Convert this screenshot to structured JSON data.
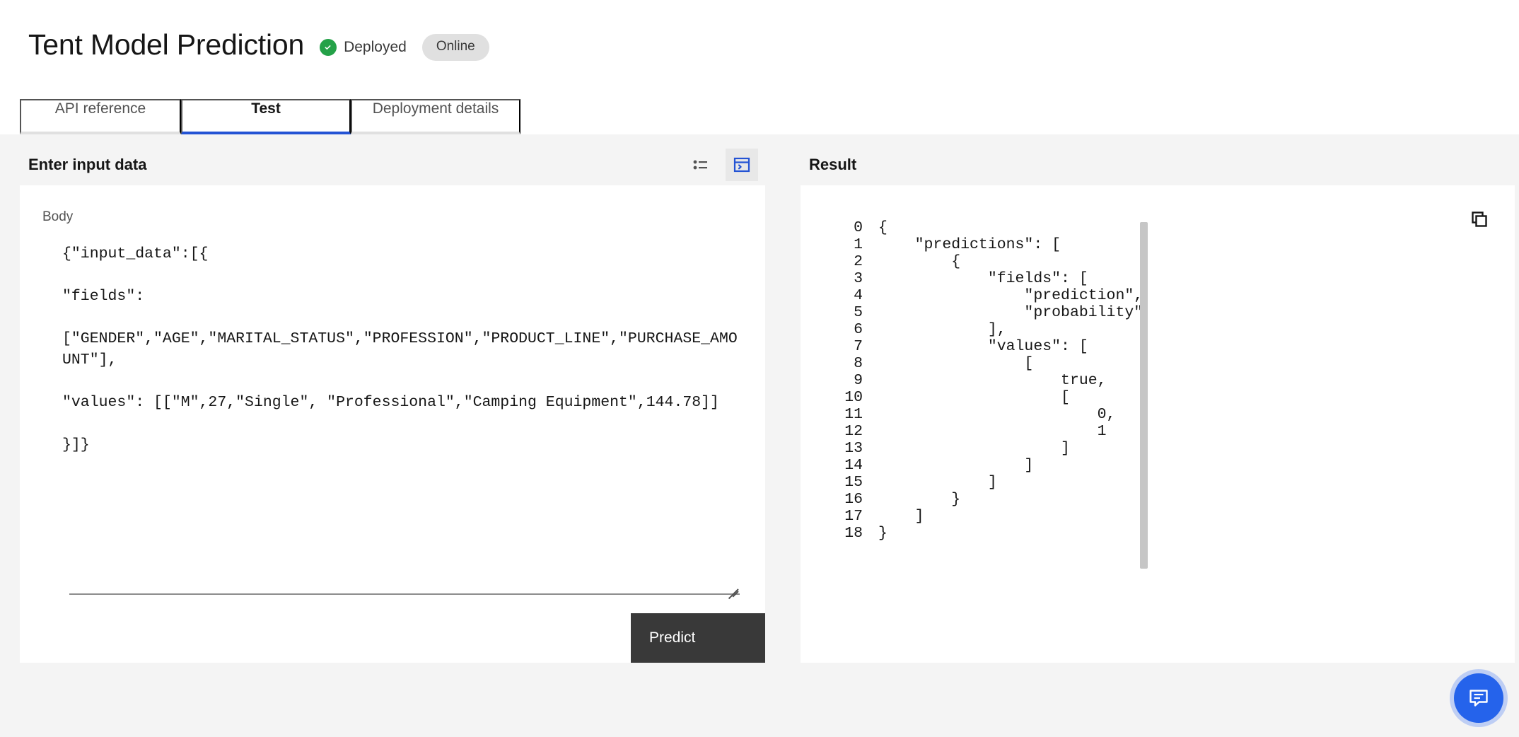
{
  "header": {
    "title": "Tent Model Prediction",
    "status_icon": "check-circle-filled-icon",
    "status_label": "Deployed",
    "status_color": "#24a148",
    "online_badge": "Online"
  },
  "tabs": [
    {
      "label": "API reference",
      "active": false
    },
    {
      "label": "Test",
      "active": true
    },
    {
      "label": "Deployment details",
      "active": false
    }
  ],
  "input_panel": {
    "title": "Enter input data",
    "icons": [
      {
        "name": "form-list-icon",
        "active": false
      },
      {
        "name": "code-editor-icon",
        "active": true,
        "color": "#2353d4"
      }
    ],
    "body_label": "Body",
    "body_value": "{\"input_data\":[{\n\n\"fields\":\n\n[\"GENDER\",\"AGE\",\"MARITAL_STATUS\",\"PROFESSION\",\"PRODUCT_LINE\",\"PURCHASE_AMOUNT\"],\n\n\"values\": [[\"M\",27,\"Single\", \"Professional\",\"Camping Equipment\",144.78]]\n\n}]}",
    "submit_label": "Predict",
    "submit_color": "#393939"
  },
  "result_panel": {
    "title": "Result",
    "copy_icon": "copy-icon",
    "line_numbers": "0\n1\n2\n3\n4\n5\n6\n7\n8\n9\n10\n11\n12\n13\n14\n15\n16\n17\n18",
    "code": "{\n    \"predictions\": [\n        {\n            \"fields\": [\n                \"prediction\",\n                \"probability\"\n            ],\n            \"values\": [\n                [\n                    true,\n                    [\n                        0,\n                        1\n                    ]\n                ]\n            ]\n        }\n    ]\n}"
  },
  "chat": {
    "icon": "chat-bubble-icon",
    "color": "#2563eb"
  }
}
